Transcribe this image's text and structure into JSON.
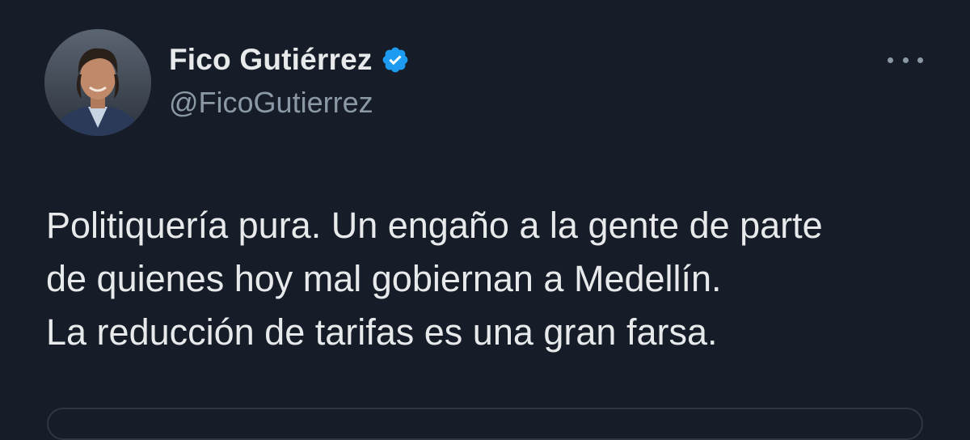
{
  "tweet": {
    "display_name": "Fico Gutiérrez",
    "handle": "@FicoGutierrez",
    "verified_icon": "verified-badge-icon",
    "more_icon": "more-options-icon",
    "text_lines": [
      "Politiquería pura. Un engaño a la gente de parte",
      "de quienes hoy mal gobiernan a Medellín.",
      "La reducción de tarifas es una gran farsa."
    ]
  },
  "colors": {
    "background": "#161d28",
    "text": "#e7e9ea",
    "secondary": "#8b98a5",
    "verified_blue": "#1d9bf0"
  }
}
